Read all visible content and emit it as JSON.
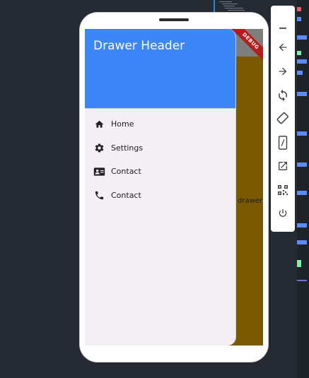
{
  "drawer": {
    "header_title": "Drawer Header",
    "items": [
      {
        "label": "Home",
        "icon": "home-icon"
      },
      {
        "label": "Settings",
        "icon": "gear-icon"
      },
      {
        "label": "Contact",
        "icon": "contact-card-icon"
      },
      {
        "label": "Contact",
        "icon": "phone-icon"
      }
    ]
  },
  "app": {
    "body_text": "drawer",
    "debug_banner": "DEBUG"
  },
  "toolbar": {
    "tools": [
      "minimize-icon",
      "back-icon",
      "forward-icon",
      "rotate-icon",
      "rotate-device-icon",
      "fold-icon",
      "open-external-icon",
      "qr-code-icon",
      "power-icon"
    ]
  },
  "colors": {
    "header": "#3d86f7",
    "drawer_bg": "#f4eef5",
    "app_body": "#7a5a00",
    "ribbon": "#b71c1c"
  }
}
